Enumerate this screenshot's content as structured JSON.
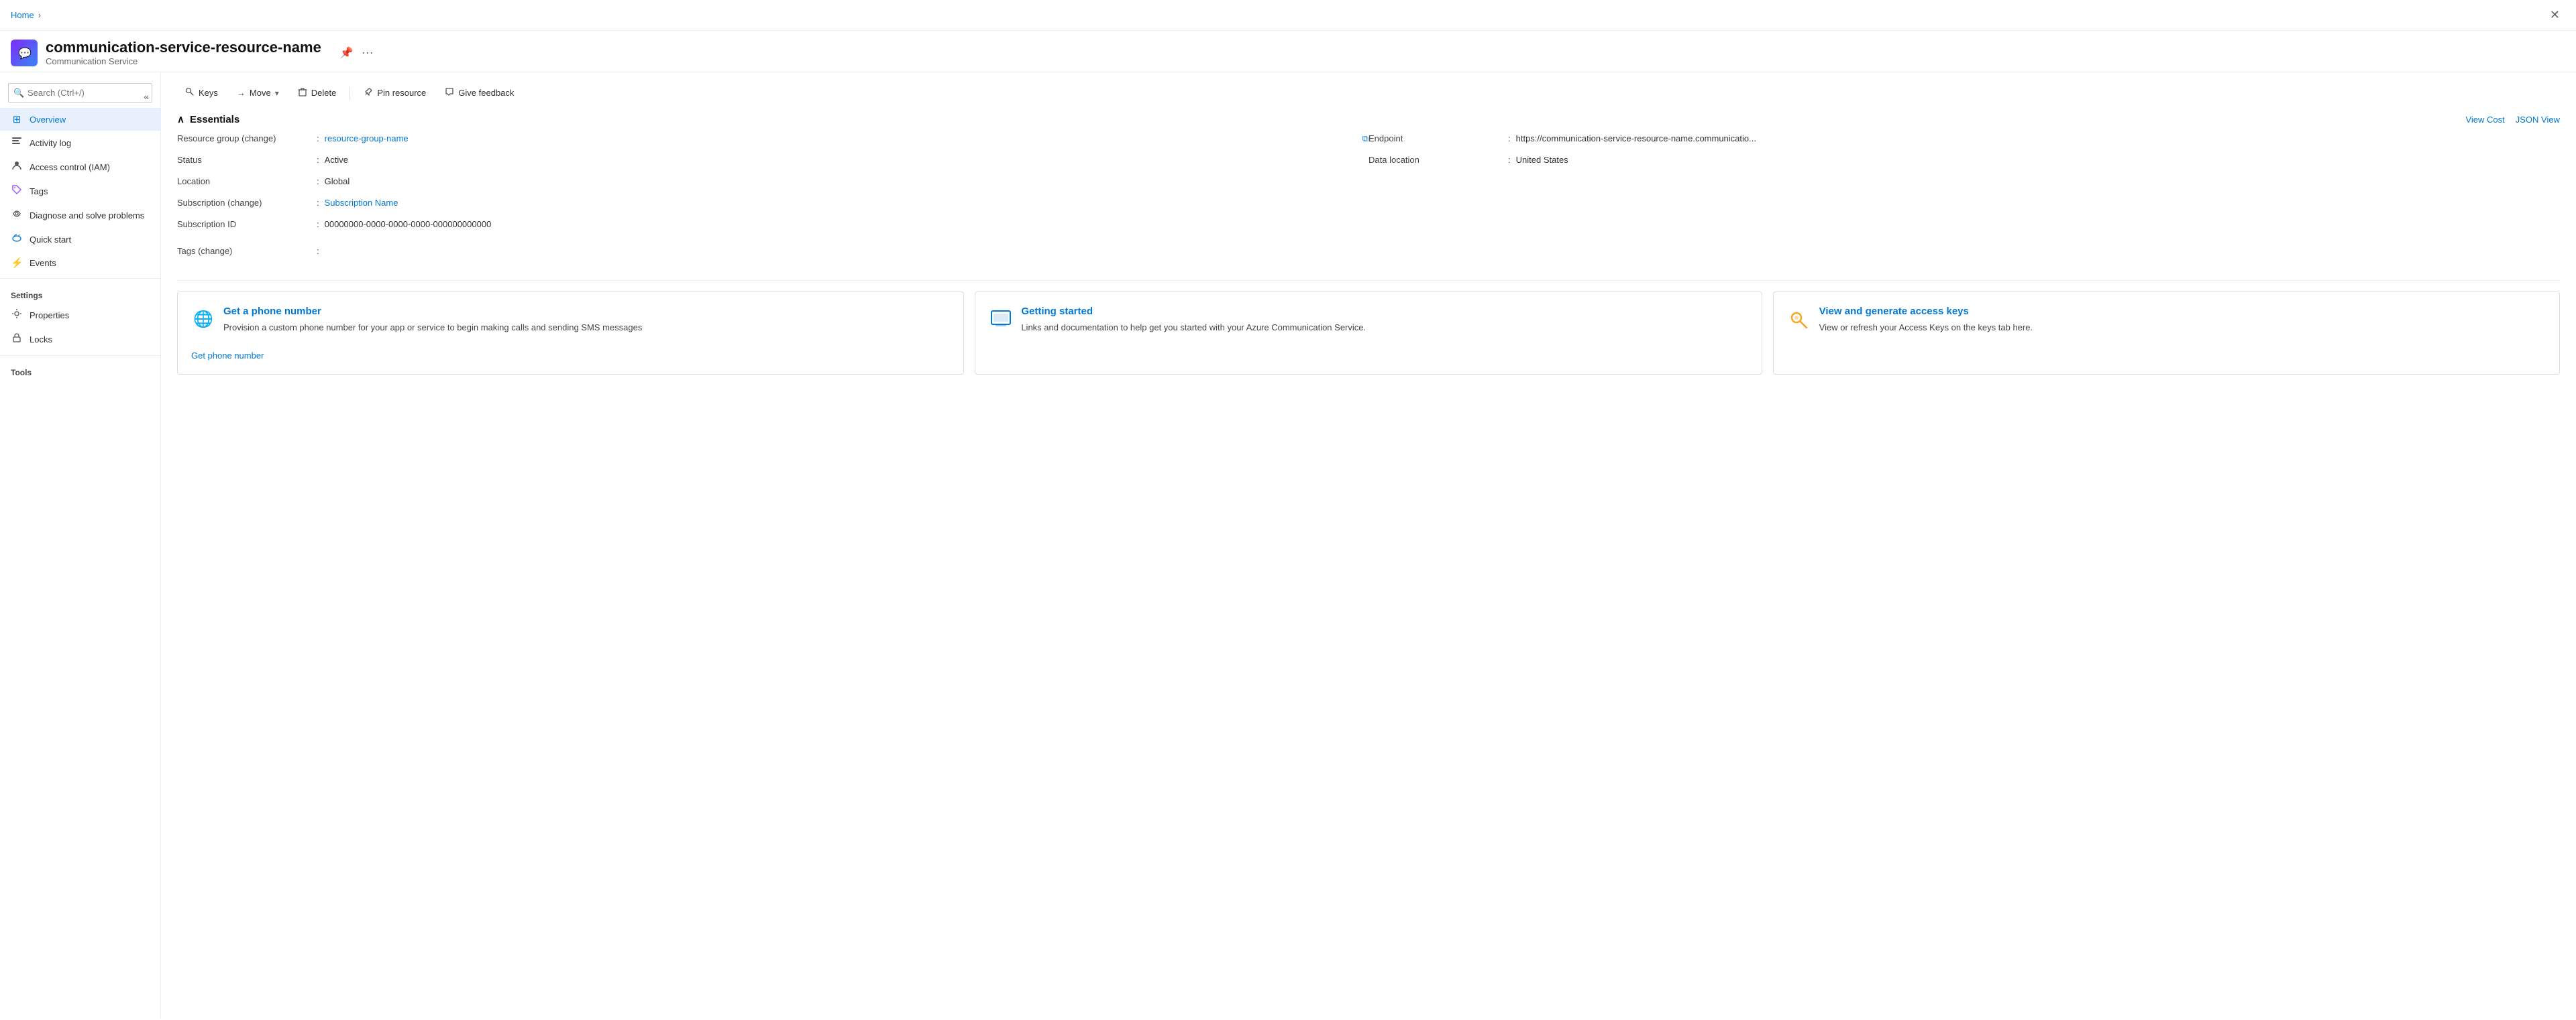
{
  "breadcrumb": {
    "home_label": "Home",
    "separator": "›"
  },
  "resource": {
    "name": "communication-service-resource-name",
    "type": "Communication Service",
    "icon": "💬"
  },
  "resource_actions": {
    "pin_label": "📌",
    "more_label": "···"
  },
  "close_button": "✕",
  "toolbar": {
    "keys_label": "Keys",
    "move_label": "Move",
    "delete_label": "Delete",
    "pin_label": "Pin resource",
    "feedback_label": "Give feedback"
  },
  "essentials": {
    "title": "Essentials",
    "view_cost_label": "View Cost",
    "json_view_label": "JSON View",
    "fields": {
      "resource_group_label": "Resource group (change)",
      "resource_group_value": "resource-group-name",
      "status_label": "Status",
      "status_value": "Active",
      "location_label": "Location",
      "location_value": "Global",
      "subscription_label": "Subscription (change)",
      "subscription_value": "Subscription Name",
      "subscription_id_label": "Subscription ID",
      "subscription_id_value": "00000000-0000-0000-0000-000000000000",
      "endpoint_label": "Endpoint",
      "endpoint_value": "https://communication-service-resource-name.communicatio...",
      "data_location_label": "Data location",
      "data_location_value": "United States",
      "tags_label": "Tags (change)"
    }
  },
  "sidebar": {
    "search_placeholder": "Search (Ctrl+/)",
    "items": [
      {
        "id": "overview",
        "label": "Overview",
        "icon": "⊞",
        "active": true
      },
      {
        "id": "activity-log",
        "label": "Activity log",
        "icon": "📋",
        "active": false
      },
      {
        "id": "access-control",
        "label": "Access control (IAM)",
        "icon": "👤",
        "active": false
      },
      {
        "id": "tags",
        "label": "Tags",
        "icon": "🏷️",
        "active": false
      },
      {
        "id": "diagnose",
        "label": "Diagnose and solve problems",
        "icon": "🔧",
        "active": false
      },
      {
        "id": "quick-start",
        "label": "Quick start",
        "icon": "☁️",
        "active": false
      },
      {
        "id": "events",
        "label": "Events",
        "icon": "⚡",
        "active": false
      }
    ],
    "settings_label": "Settings",
    "settings_items": [
      {
        "id": "properties",
        "label": "Properties",
        "icon": "⚙️",
        "active": false
      },
      {
        "id": "locks",
        "label": "Locks",
        "icon": "🔒",
        "active": false
      }
    ],
    "tools_label": "Tools"
  },
  "cards": [
    {
      "id": "phone-number",
      "icon": "🌐",
      "icon_color": "#0078d4",
      "title": "Get a phone number",
      "description": "Provision a custom phone number for your app or service to begin making calls and sending SMS messages",
      "link_label": "Get phone number"
    },
    {
      "id": "getting-started",
      "icon": "🖥️",
      "icon_color": "#0078d4",
      "title": "Getting started",
      "description": "Links and documentation to help get you started with your Azure Communication Service.",
      "link_label": null
    },
    {
      "id": "access-keys",
      "icon": "🔑",
      "icon_color": "#f5a623",
      "title": "View and generate access keys",
      "description": "View or refresh your Access Keys on the keys tab here.",
      "link_label": null
    }
  ]
}
